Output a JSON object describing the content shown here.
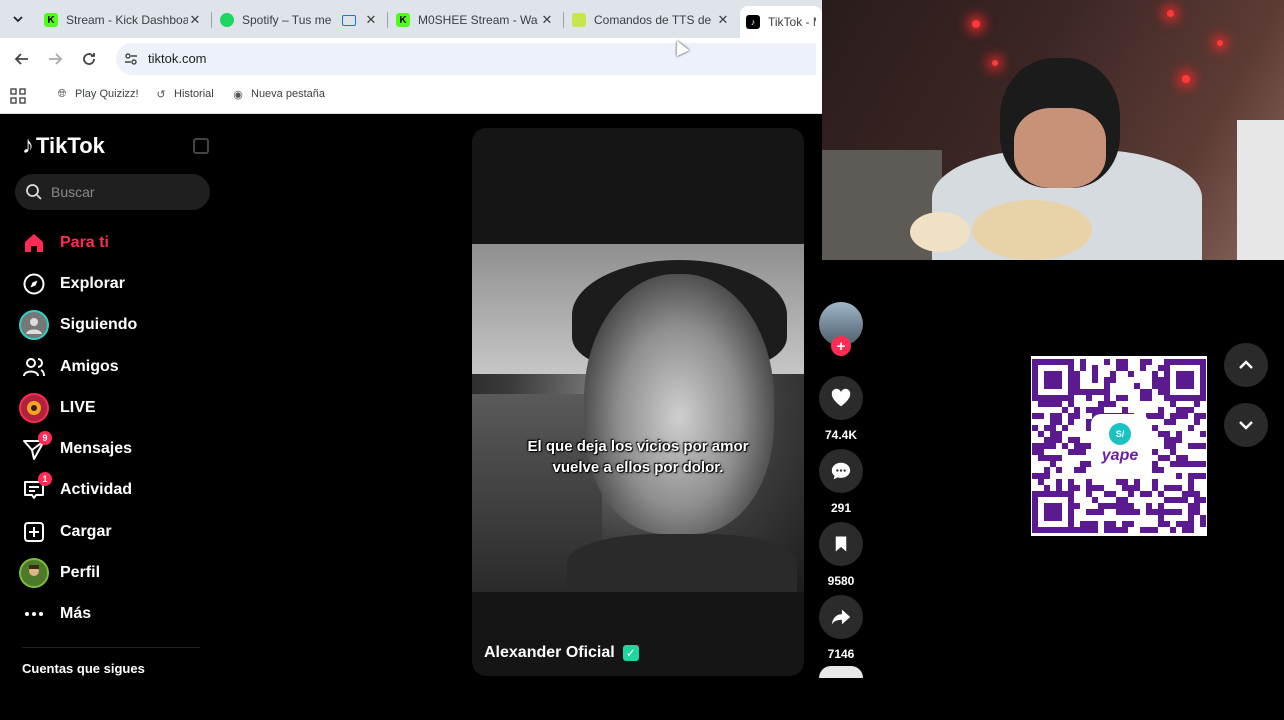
{
  "browser": {
    "tabs": [
      {
        "label": "Stream - Kick Dashboa",
        "icon": "kick-icon",
        "color": "#53fc18"
      },
      {
        "label": "Spotify – Tus me",
        "icon": "spotify-icon",
        "color": "#1ed760"
      },
      {
        "label": "M0SHEE Stream - Wa",
        "icon": "kick-icon",
        "color": "#53fc18"
      },
      {
        "label": "Comandos de TTS de",
        "icon": "tts-icon",
        "color": "#c8e64c"
      },
      {
        "label": "TikTok - M",
        "icon": "tiktok-icon",
        "color": "#000000"
      }
    ],
    "url": "tiktok.com",
    "bookmarks": [
      {
        "label": "Play Quizizz!",
        "icon": "globe-icon"
      },
      {
        "label": "Historial",
        "icon": "history-icon"
      },
      {
        "label": "Nueva pestaña",
        "icon": "chrome-icon"
      }
    ]
  },
  "tiktok": {
    "logo": "TikTok",
    "search_placeholder": "Buscar",
    "nav": [
      {
        "label": "Para ti",
        "icon": "home-icon",
        "active": true
      },
      {
        "label": "Explorar",
        "icon": "compass-icon"
      },
      {
        "label": "Siguiendo",
        "icon": "following-avatar-icon"
      },
      {
        "label": "Amigos",
        "icon": "friends-icon"
      },
      {
        "label": "LIVE",
        "icon": "live-icon"
      },
      {
        "label": "Mensajes",
        "icon": "messages-icon",
        "badge": "9"
      },
      {
        "label": "Actividad",
        "icon": "activity-icon",
        "badge": "1"
      },
      {
        "label": "Cargar",
        "icon": "upload-icon"
      },
      {
        "label": "Perfil",
        "icon": "profile-avatar-icon"
      },
      {
        "label": "Más",
        "icon": "more-icon"
      }
    ],
    "following_heading": "Cuentas que sigues",
    "accent": "#fe2c55"
  },
  "video": {
    "caption": "El que deja los vicios por amor vuelve a ellos por dolor.",
    "author": "Alexander Oficial",
    "actions": {
      "likes": "74.4K",
      "comments": "291",
      "saves": "9580",
      "shares": "7146"
    }
  },
  "overlay": {
    "qr_brand": "yape",
    "qr_symbol": "S/"
  }
}
